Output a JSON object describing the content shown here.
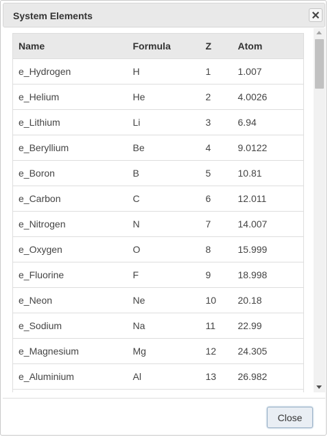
{
  "dialog": {
    "title": "System Elements",
    "close_label": "Close"
  },
  "table": {
    "headers": [
      "Name",
      "Formula",
      "Z",
      "Atom"
    ],
    "rows": [
      {
        "name": "e_Hydrogen",
        "formula": "H",
        "z": "1",
        "atom": "1.007"
      },
      {
        "name": "e_Helium",
        "formula": "He",
        "z": "2",
        "atom": "4.0026"
      },
      {
        "name": "e_Lithium",
        "formula": "Li",
        "z": "3",
        "atom": "6.94"
      },
      {
        "name": "e_Beryllium",
        "formula": "Be",
        "z": "4",
        "atom": "9.0122"
      },
      {
        "name": "e_Boron",
        "formula": "B",
        "z": "5",
        "atom": "10.81"
      },
      {
        "name": "e_Carbon",
        "formula": "C",
        "z": "6",
        "atom": "12.011"
      },
      {
        "name": "e_Nitrogen",
        "formula": "N",
        "z": "7",
        "atom": "14.007"
      },
      {
        "name": "e_Oxygen",
        "formula": "O",
        "z": "8",
        "atom": "15.999"
      },
      {
        "name": "e_Fluorine",
        "formula": "F",
        "z": "9",
        "atom": "18.998"
      },
      {
        "name": "e_Neon",
        "formula": "Ne",
        "z": "10",
        "atom": "20.18"
      },
      {
        "name": "e_Sodium",
        "formula": "Na",
        "z": "11",
        "atom": "22.99"
      },
      {
        "name": "e_Magnesium",
        "formula": "Mg",
        "z": "12",
        "atom": "24.305"
      },
      {
        "name": "e_Aluminium",
        "formula": "Al",
        "z": "13",
        "atom": "26.982"
      },
      {
        "name": "",
        "formula": "",
        "z": "",
        "atom": ""
      }
    ]
  },
  "icons": {
    "title_close": "close-icon",
    "scroll_up": "scroll-up-arrow-icon",
    "scroll_down": "scroll-down-arrow-icon"
  }
}
